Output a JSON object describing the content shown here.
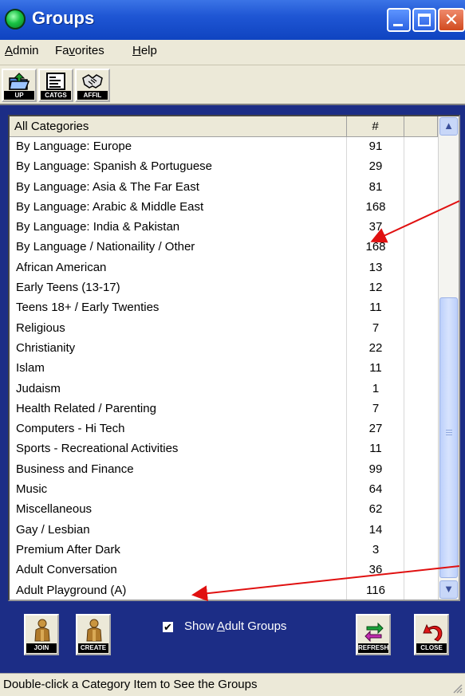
{
  "window": {
    "title": "Groups"
  },
  "menu": [
    {
      "label_pre": "",
      "underline": "A",
      "label_post": "dmin"
    },
    {
      "label_pre": "Fa",
      "underline": "v",
      "label_post": "orites"
    },
    {
      "label_pre": "",
      "underline": "H",
      "label_post": "elp"
    }
  ],
  "toolbar": {
    "up_label": "UP",
    "catgs_label": "CATGS",
    "affil_label": "AFFIL"
  },
  "list": {
    "col_category": "All Categories",
    "col_count": "#",
    "rows": [
      {
        "name": "By Language: Europe",
        "count": "91"
      },
      {
        "name": "By Language: Spanish & Portuguese",
        "count": "29"
      },
      {
        "name": "By Language: Asia & The Far East",
        "count": "81"
      },
      {
        "name": "By Language: Arabic & Middle East",
        "count": "168"
      },
      {
        "name": "By Language: India & Pakistan",
        "count": "37"
      },
      {
        "name": "By Language / Nationaility / Other",
        "count": "168"
      },
      {
        "name": "African American",
        "count": "13"
      },
      {
        "name": "Early Teens (13-17)",
        "count": "12"
      },
      {
        "name": "Teens 18+ / Early Twenties",
        "count": "11"
      },
      {
        "name": "Religious",
        "count": "7"
      },
      {
        "name": "Christianity",
        "count": "22"
      },
      {
        "name": "Islam",
        "count": "11"
      },
      {
        "name": "Judaism",
        "count": "1"
      },
      {
        "name": "Health Related / Parenting",
        "count": "7"
      },
      {
        "name": "Computers - Hi Tech",
        "count": "27"
      },
      {
        "name": "Sports - Recreational Activities",
        "count": "11"
      },
      {
        "name": "Business and Finance",
        "count": "99"
      },
      {
        "name": "Music",
        "count": "64"
      },
      {
        "name": "Miscellaneous",
        "count": "62"
      },
      {
        "name": "Gay / Lesbian",
        "count": "14"
      },
      {
        "name": "Premium After Dark",
        "count": "3"
      },
      {
        "name": "Adult Conversation",
        "count": "36"
      },
      {
        "name": "Adult Playground (A)",
        "count": "116"
      }
    ]
  },
  "bottom": {
    "join_label": "JOIN",
    "create_label": "CREATE",
    "refresh_label": "REFRESH",
    "close_label": "CLOSE",
    "show_adult_pre": "Show ",
    "show_adult_ul": "A",
    "show_adult_post": "dult Groups",
    "show_adult_checked": true
  },
  "status": {
    "text": "Double-click a Category Item to See the Groups"
  },
  "colors": {
    "window_bg": "#1c2d86",
    "titlebar": "#1f56d4",
    "annotation_arrow": "#e01010"
  }
}
